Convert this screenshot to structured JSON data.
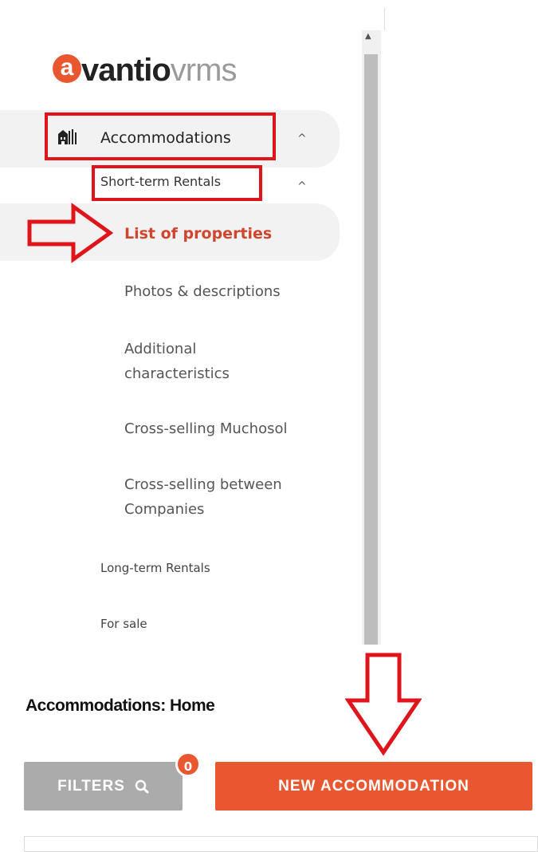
{
  "logo": {
    "a": "a",
    "brand": "vantio",
    "suffix": "vrms"
  },
  "sidebar": {
    "accommodations_label": "Accommodations",
    "short_term_label": "Short-term Rentals",
    "list_label": "List of properties",
    "items": [
      "Photos & descriptions",
      "Additional characteristics",
      "Cross-selling Muchosol",
      "Cross-selling between Companies"
    ],
    "long_term_label": "Long-term Rentals",
    "for_sale_label": "For sale",
    "chevron": "^"
  },
  "page": {
    "title": "Accommodations: Home",
    "filters_label": "FILTERS",
    "filters_count": "0",
    "new_button_label": "NEW ACCOMMODATION"
  },
  "colors": {
    "accent": "#e8572f",
    "highlight": "#e0141b",
    "active_text": "#d0452e",
    "filter_btn": "#ababab"
  },
  "icons": [
    "buildings-icon",
    "chevron-up-icon",
    "search-icon",
    "arrow-right-annotation",
    "arrow-down-annotation"
  ]
}
